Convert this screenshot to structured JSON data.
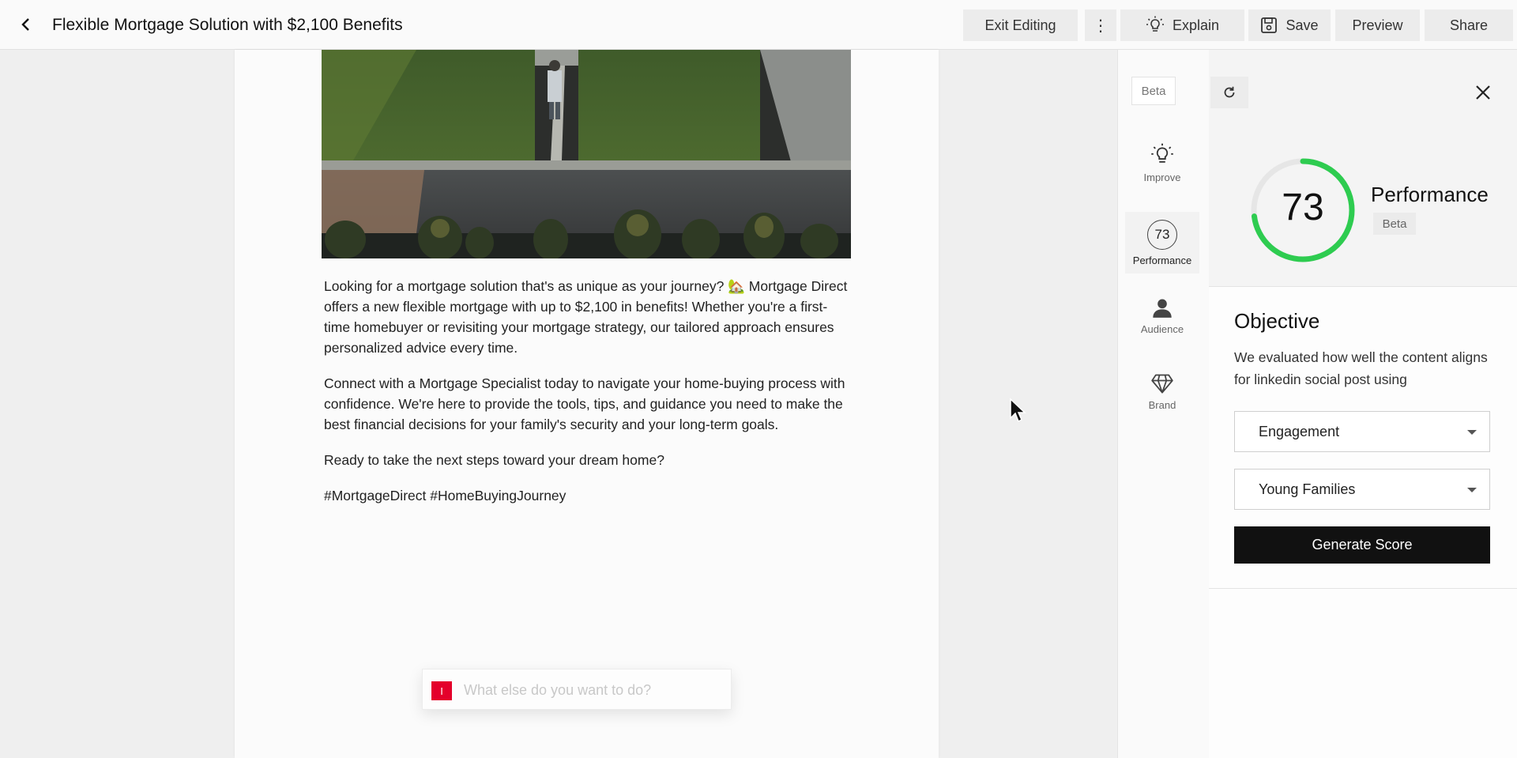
{
  "header": {
    "title": "Flexible Mortgage Solution with $2,100 Benefits",
    "exit_editing": "Exit Editing",
    "more_label": "⋮",
    "explain": "Explain",
    "save": "Save",
    "preview": "Preview",
    "share": "Share"
  },
  "post": {
    "paragraphs": [
      "Looking for a mortgage solution that's as unique as your journey? 🏡 Mortgage Direct offers a new flexible mortgage with up to $2,100 in benefits! Whether you're a first-time homebuyer or revisiting your mortgage strategy, our tailored approach ensures personalized advice every time.",
      "Connect with a Mortgage Specialist today to navigate your home-buying process with confidence. We're here to provide the tools, tips, and guidance you need to make the best financial decisions for your family's security and your long-term goals.",
      "Ready to take the next steps toward your dream home?",
      "#MortgageDirect #HomeBuyingJourney"
    ]
  },
  "prompt": {
    "mark": "I",
    "placeholder": "What else do you want to do?"
  },
  "rail": {
    "beta": "Beta",
    "improve": "Improve",
    "performance_score": "73",
    "performance": "Performance",
    "audience": "Audience",
    "brand": "Brand"
  },
  "panel": {
    "score": "73",
    "score_fraction": 0.73,
    "gauge_color": "#2ecc50",
    "performance_title": "Performance",
    "performance_beta": "Beta",
    "objective_title": "Objective",
    "objective_desc": "We evaluated how well the content aligns for linkedin social post using",
    "objective_select": "Engagement",
    "audience_select": "Young Families",
    "generate_button": "Generate Score"
  }
}
